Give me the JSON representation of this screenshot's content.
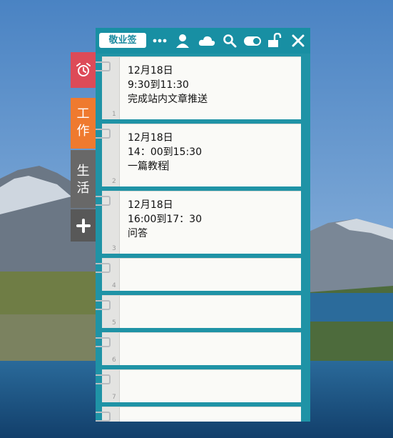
{
  "app": {
    "brand_label": "敬业签",
    "toolbar_icons": [
      "more-icon",
      "user-icon",
      "cloud-icon",
      "search-icon",
      "toggle-icon",
      "unlock-icon",
      "close-icon"
    ]
  },
  "side_tabs": [
    {
      "icon": "alarm-clock-icon",
      "color": "#dd4b58"
    },
    {
      "label": "工作",
      "chars": [
        "工",
        "作"
      ],
      "color": "#ef7a2f"
    },
    {
      "label": "生活",
      "chars": [
        "生",
        "活"
      ],
      "color": "#686868"
    },
    {
      "icon": "plus-icon",
      "label": "+",
      "color": "#585858"
    }
  ],
  "notes": [
    {
      "number": "1",
      "lines": [
        "12月18日",
        "9:30到11:30",
        "完成站内文章推送"
      ]
    },
    {
      "number": "2",
      "lines": [
        "12月18日",
        "14：00到15:30",
        "一篇教程"
      ]
    },
    {
      "number": "3",
      "lines": [
        "12月18日",
        "16:00到17：30",
        "问答"
      ]
    },
    {
      "number": "4",
      "lines": []
    },
    {
      "number": "5",
      "lines": []
    },
    {
      "number": "6",
      "lines": []
    },
    {
      "number": "7",
      "lines": []
    }
  ],
  "colors": {
    "accent": "#1f93a6",
    "alarm_tab": "#dd4b58",
    "work_tab": "#ef7a2f",
    "life_tab": "#686868"
  }
}
